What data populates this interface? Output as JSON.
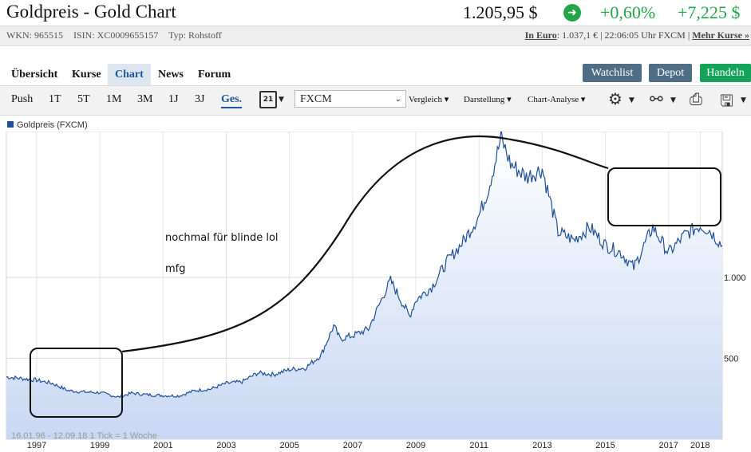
{
  "header": {
    "title": "Goldpreis - Gold Chart",
    "price": "1.205,95 $",
    "change_pct": "+0,60%",
    "change_abs": "+7,225 $",
    "trend_icon": "arrow-up-circle-icon",
    "wkn": "WKN: 965515",
    "isin": "ISIN: XC0009655157",
    "typ": "Typ: Rohstoff",
    "euro_label": "In Euro",
    "euro_value": ": 1.037,1 € | 22:06:05 Uhr FXCM |",
    "more_link": "Mehr Kurse »"
  },
  "nav": {
    "tabs": [
      "Übersicht",
      "Kurse",
      "Chart",
      "News",
      "Forum"
    ],
    "buttons": {
      "watchlist": "Watchlist",
      "depot": "Depot",
      "handeln": "Handeln"
    }
  },
  "toolbar": {
    "periods": [
      "Push",
      "1T",
      "5T",
      "1M",
      "3M",
      "1J",
      "3J",
      "Ges."
    ],
    "active_period": "Ges.",
    "calendar_day": "21",
    "exchange": "FXCM",
    "menus": [
      "Vergleich",
      "Darstellung",
      "Chart-Analyse"
    ],
    "icons": [
      "gear-icon",
      "nodes-icon",
      "print-icon",
      "save-icon"
    ]
  },
  "chart_data": {
    "type": "area",
    "series": [
      {
        "name": "Goldpreis (FXCM)",
        "x": [
          1996.04,
          1997.0,
          1997.5,
          1998.0,
          1998.5,
          1999.0,
          1999.6,
          2000.0,
          2000.5,
          2001.0,
          2001.5,
          2002.0,
          2002.5,
          2003.0,
          2003.5,
          2004.0,
          2004.5,
          2005.0,
          2005.5,
          2006.0,
          2006.4,
          2006.6,
          2007.0,
          2007.5,
          2008.0,
          2008.2,
          2008.8,
          2009.0,
          2009.5,
          2010.0,
          2010.5,
          2011.0,
          2011.3,
          2011.7,
          2012.0,
          2012.5,
          2013.0,
          2013.5,
          2014.0,
          2014.5,
          2015.0,
          2015.5,
          2015.9,
          2016.5,
          2017.0,
          2017.5,
          2018.0,
          2018.3,
          2018.7
        ],
        "values": [
          385,
          365,
          345,
          300,
          292,
          288,
          260,
          285,
          275,
          270,
          268,
          300,
          310,
          345,
          355,
          410,
          400,
          430,
          440,
          520,
          700,
          620,
          640,
          680,
          900,
          980,
          760,
          860,
          940,
          1100,
          1220,
          1380,
          1550,
          1860,
          1700,
          1620,
          1670,
          1280,
          1230,
          1310,
          1200,
          1150,
          1060,
          1310,
          1150,
          1260,
          1320,
          1290,
          1196
        ]
      }
    ],
    "x_ticks": [
      "1997",
      "1999",
      "2001",
      "2003",
      "2005",
      "2007",
      "2009",
      "2011",
      "2013",
      "2015",
      "2017",
      "2018"
    ],
    "y_ticks": [
      "1.000",
      "500"
    ],
    "xlim": [
      1996.04,
      2018.7
    ],
    "ylim": [
      0,
      1900
    ],
    "footer": "16.01.96 - 12.09.18   1 Tick = 1 Woche",
    "annotations": [
      "nochmal für blinde lol",
      "mfg"
    ],
    "line_color": "#1f4f99",
    "fill_color": "#c8d8f3"
  }
}
